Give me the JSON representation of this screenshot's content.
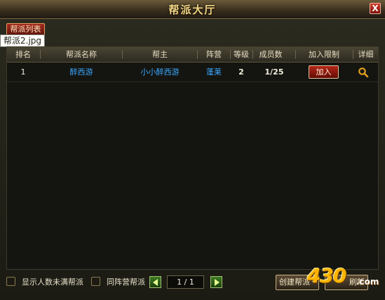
{
  "window": {
    "title": "帮派大厅",
    "close_label": "X"
  },
  "tab": {
    "label": "帮派列表"
  },
  "tooltip": {
    "text": "帮派2.jpg"
  },
  "table": {
    "columns": [
      "排名",
      "帮派名称",
      "帮主",
      "阵营",
      "等级",
      "成员数",
      "加入限制",
      "详细"
    ],
    "rows": [
      {
        "rank": "1",
        "name": "醉西游",
        "leader": "小小醉西游",
        "faction": "蓬莱",
        "level": "2",
        "members": "1/25",
        "join_label": "加入"
      }
    ]
  },
  "footer": {
    "checkbox_not_full": "显示人数未满帮派",
    "checkbox_same_faction": "同阵营帮派",
    "page": "1 / 1",
    "create_button": "创建帮派",
    "second_button": "刷新"
  },
  "watermark": {
    "text": "430",
    "suffix": ".com"
  },
  "colors": {
    "accent_red": "#a32b1c",
    "link_blue": "#3aa8ff",
    "gold": "#f2d88a"
  }
}
